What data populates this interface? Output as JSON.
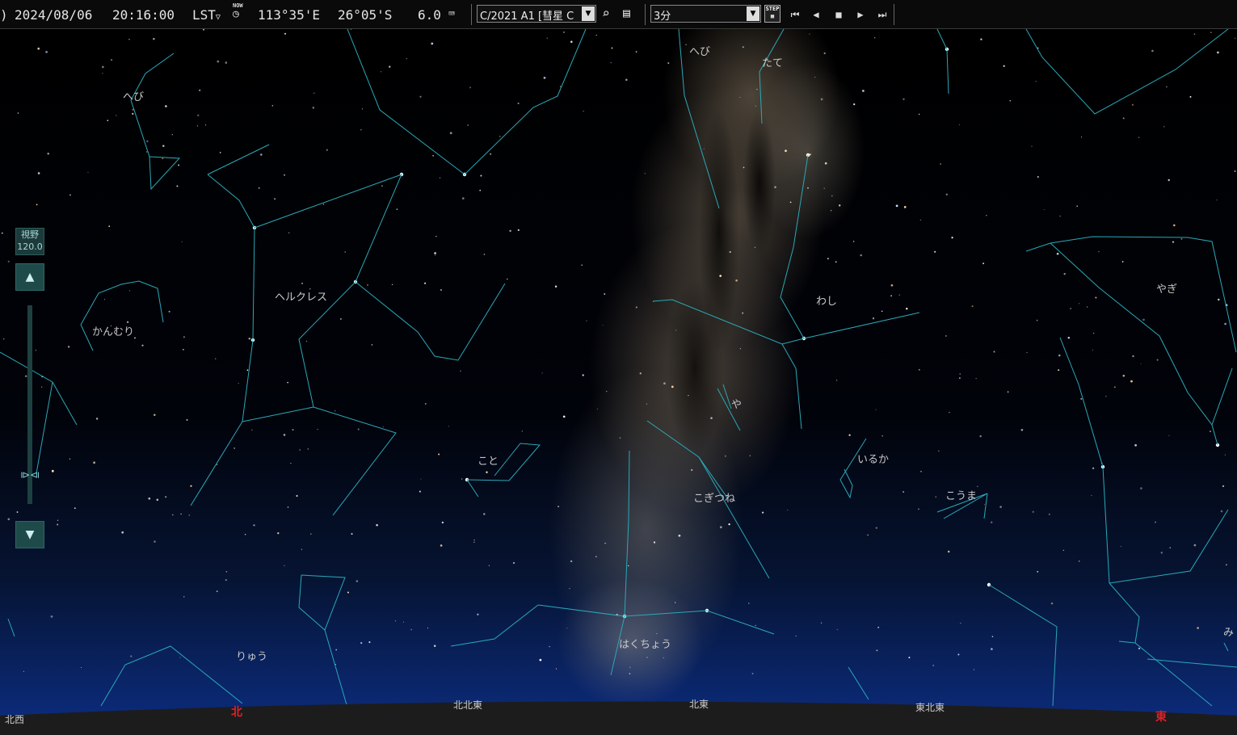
{
  "toolbar": {
    "date": "2024/08/06",
    "time": "20:16:00",
    "time_mode": "LST",
    "now_label": "NOW",
    "longitude": "113°35'E",
    "latitude": "26°05'S",
    "limiting_magnitude": "6.0",
    "comet_select": "C/2021 A1 [彗星 C",
    "step_select": "3分",
    "step_label": "STEP"
  },
  "fov": {
    "label": "視野",
    "value": "120.0"
  },
  "constellations": [
    {
      "name": "へび"
    },
    {
      "name": "へび"
    },
    {
      "name": "たて"
    },
    {
      "name": "ヘルクレス"
    },
    {
      "name": "かんむり"
    },
    {
      "name": "わし"
    },
    {
      "name": "やぎ"
    },
    {
      "name": "や"
    },
    {
      "name": "こと"
    },
    {
      "name": "いるか"
    },
    {
      "name": "こうま"
    },
    {
      "name": "こぎつね"
    },
    {
      "name": "はくちょう"
    },
    {
      "name": "りゅう"
    },
    {
      "name": "み"
    }
  ],
  "horizon": {
    "directions": [
      {
        "label": "北西",
        "red": false
      },
      {
        "label": "北",
        "red": true
      },
      {
        "label": "北北東",
        "red": false
      },
      {
        "label": "北東",
        "red": false
      },
      {
        "label": "東北東",
        "red": false
      },
      {
        "label": "東",
        "red": true
      }
    ]
  },
  "colors": {
    "constellation_line": "#2aa8b8",
    "horizon_ground": "#1c1c1c",
    "cardinal": "#e0202a",
    "sky_top": "#000000",
    "sky_bottom": "#0a2a7a"
  }
}
